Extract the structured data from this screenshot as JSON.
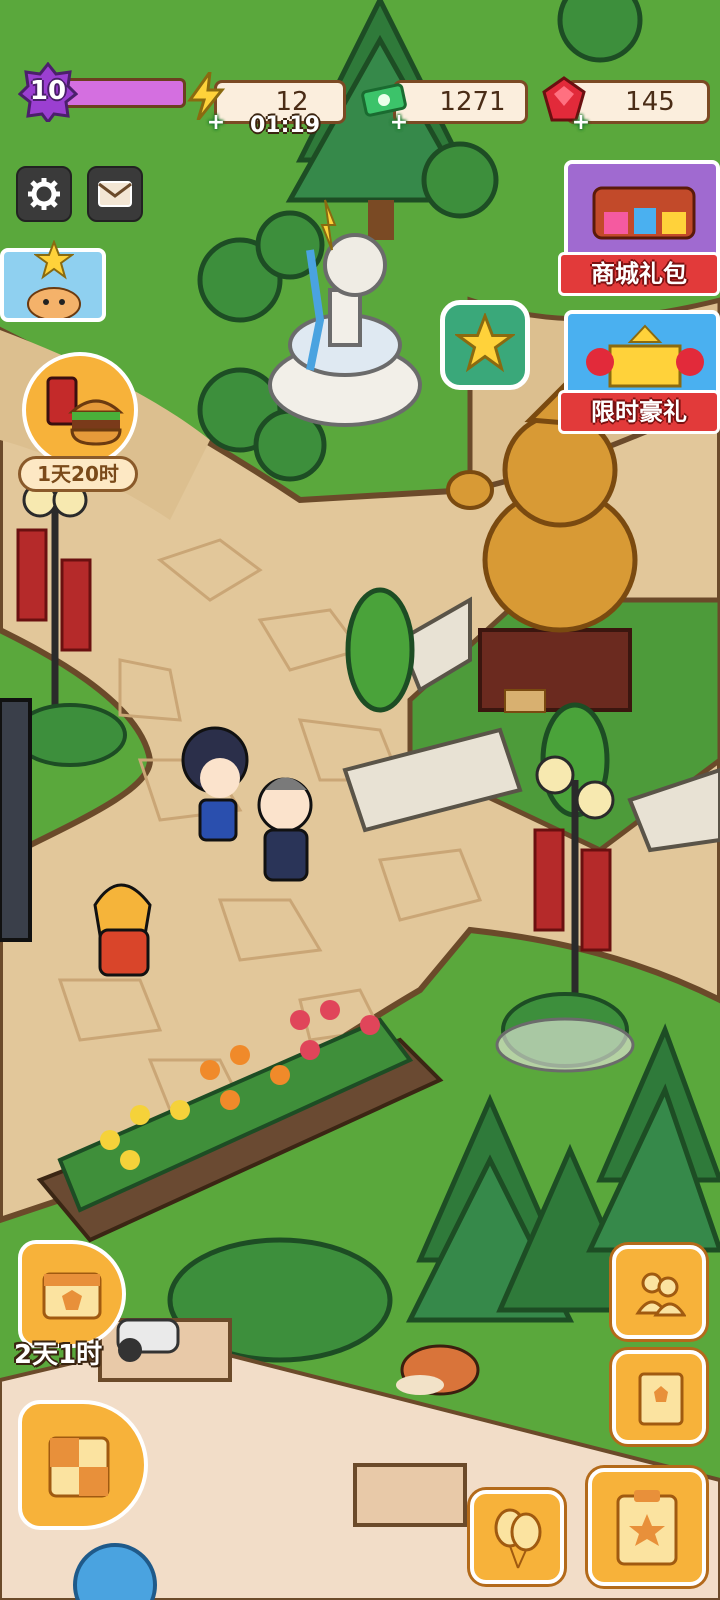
{
  "hud": {
    "level": "10",
    "energy": {
      "value": "12",
      "timer": "01:19",
      "icon": "lightning-icon"
    },
    "cash": {
      "value": "1271",
      "icon": "cash-icon"
    },
    "gems": {
      "value": "145",
      "icon": "ruby-icon"
    }
  },
  "buttons": {
    "settings": "gear-icon",
    "mail": "envelope-icon"
  },
  "right_panel": {
    "shop_gift": "商城礼包",
    "limited_gift": "限时豪礼"
  },
  "events": {
    "food_event_timer": "1天20时",
    "calendar_event_timer": "2天1时"
  },
  "colors": {
    "grass": "#5aa83c",
    "path": "#e2c79a",
    "accent_orange": "#f7b23a",
    "banner_red": "#e23a3a"
  }
}
